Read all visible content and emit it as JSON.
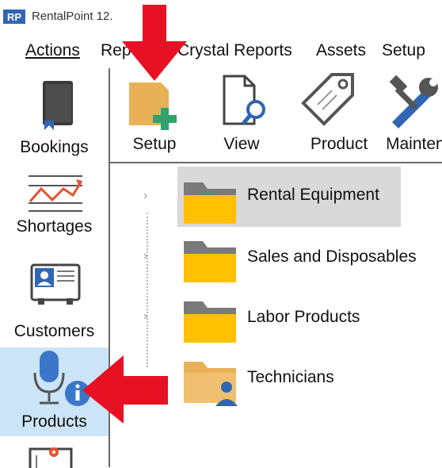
{
  "window": {
    "logo_text": "RP",
    "title": "RentalPoint 12."
  },
  "menu": {
    "actions": "Actions",
    "reports": "Reports",
    "crystal_reports": "Crystal Reports",
    "assets": "Assets",
    "setup": "Setup"
  },
  "sidebar": {
    "items": [
      {
        "label": "Bookings",
        "icon": "book-icon"
      },
      {
        "label": "Shortages",
        "icon": "chart-line-icon"
      },
      {
        "label": "Customers",
        "icon": "contact-card-icon"
      },
      {
        "label": "Products",
        "icon": "microphone-info-icon",
        "active": true
      },
      {
        "label": "",
        "icon": "map-pin-icon"
      }
    ]
  },
  "toolbar": {
    "items": [
      {
        "label": "Setup",
        "icon": "add-file-icon"
      },
      {
        "label": "View",
        "icon": "file-search-icon"
      },
      {
        "label": "Product",
        "icon": "tag-icon"
      },
      {
        "label": "Maintena",
        "icon": "wrench-hammer-icon"
      }
    ]
  },
  "tree": {
    "items": [
      {
        "label": "Rental Equipment",
        "selected": true,
        "icon": "folder-icon"
      },
      {
        "label": "Sales and Disposables",
        "icon": "folder-icon"
      },
      {
        "label": "Labor Products",
        "icon": "folder-icon"
      },
      {
        "label": "Technicians",
        "icon": "folder-person-icon"
      }
    ]
  },
  "colors": {
    "accent_active": "#cce4f7",
    "folder_yellow": "#ffc000",
    "arrow_red": "#e81123",
    "icon_blue": "#3a77c8"
  },
  "annotations": [
    {
      "icon": "red-arrow-down-icon",
      "points_to": "toolbar.setup"
    },
    {
      "icon": "red-arrow-left-icon",
      "points_to": "sidebar.products"
    }
  ]
}
